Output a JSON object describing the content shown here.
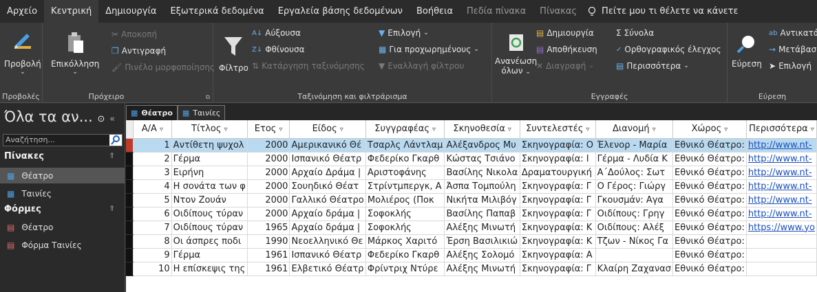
{
  "tabs": [
    {
      "label": "Αρχείο",
      "active": false,
      "contextual": false
    },
    {
      "label": "Κεντρική",
      "active": true,
      "contextual": false
    },
    {
      "label": "Δημιουργία",
      "active": false,
      "contextual": false
    },
    {
      "label": "Εξωτερικά δεδομένα",
      "active": false,
      "contextual": false
    },
    {
      "label": "Εργαλεία βάσης δεδομένων",
      "active": false,
      "contextual": false
    },
    {
      "label": "Βοήθεια",
      "active": false,
      "contextual": false
    },
    {
      "label": "Πεδία πίνακα",
      "active": false,
      "contextual": true
    },
    {
      "label": "Πίνακας",
      "active": false,
      "contextual": true
    }
  ],
  "tell_me": "Πείτε μου τι θέλετε να κάνετε",
  "ribbon": {
    "views": {
      "view": "Προβολή",
      "group": "Προβολές"
    },
    "clipboard": {
      "paste": "Επικόλληση",
      "cut": "Αποκοπή",
      "copy": "Αντιγραφή",
      "format_painter": "Πινέλο μορφοποίησης",
      "group": "Πρόχειρο"
    },
    "sort": {
      "filter": "Φίλτρο",
      "asc": "Αύξουσα",
      "desc": "Φθίνουσα",
      "remove_sort": "Κατάργηση ταξινόμησης",
      "selection": "Επιλογή",
      "advanced": "Για προχωρημένους",
      "toggle_filter": "Εναλλαγή φίλτρου",
      "group": "Ταξινόμηση και φιλτράρισμα"
    },
    "records": {
      "refresh": "Ανανέωση",
      "refresh2": "όλων",
      "new": "Δημιουργία",
      "save": "Αποθήκευση",
      "delete": "Διαγραφή",
      "totals": "Σύνολα",
      "spelling": "Ορθογραφικός έλεγχος",
      "more": "Περισσότερα",
      "group": "Εγγραφές"
    },
    "find": {
      "find": "Εύρεση",
      "replace": "Αντικατάσταση",
      "goto": "Μετάβαση",
      "select": "Επιλογή",
      "group": "Εύρεση"
    }
  },
  "nav": {
    "title": "Όλα τα αν...",
    "search_placeholder": "Αναζήτηση...",
    "tables_header": "Πίνακες",
    "tables": [
      "Θέατρο",
      "Ταινίες"
    ],
    "forms_header": "Φόρμες",
    "forms": [
      "Θέατρο",
      "Φόρμα Ταινίες"
    ]
  },
  "doc_tabs": [
    "Θέατρο",
    "Ταινίες"
  ],
  "columns": [
    "Α/Α",
    "Τίτλος",
    "Ετος",
    "Είδος",
    "Συγγραφέας",
    "Σκηνοθεσία",
    "Συντελεστές",
    "Διανομή",
    "Χώρος",
    "Περισσότερα"
  ],
  "rows": [
    [
      "1",
      "Αντίθετη ψυχολ",
      "2000",
      "Αμερικανικό Θέ",
      "Τσαρλς Λάντλαμ",
      "Αλέξανδρος Μυ",
      "Σκηνογραφία: Ο",
      "Έλενορ - Μαρία",
      "Εθνικό Θέατρο:",
      "http://www.nt-"
    ],
    [
      "2",
      "Γέρμα",
      "2000",
      "Ισπανικό Θέατρ",
      "Φεδερίκο Γκαρθ",
      "Κώστας Τσιάνο",
      "Σκηνογραφία: Ι",
      "Γέρμα - Λυδία Κ",
      "Εθνικό Θέατρο:",
      "http://www.nt-"
    ],
    [
      "3",
      "Ειρήνη",
      "2000",
      "Αρχαίο Δράμα |",
      "Αριστοφάνης",
      "Βασίλης Νικολα",
      "Δραματουργική",
      "Α΄Δούλος: Σωτ",
      "Εθνικό Θέατρο:",
      "http://www.nt-"
    ],
    [
      "4",
      "Η σονάτα των φ",
      "2000",
      "Σουηδικό Θέατ",
      "Στρίντμπεργκ, Α",
      "Άσπα Τομπούλη",
      "Σκηνογραφία: Γ",
      "Ο Γέρος: Γιώργ",
      "Εθνικό Θέατρο:",
      "http://www.nt-"
    ],
    [
      "5",
      "Ντον Ζουάν",
      "2000",
      "Γαλλικό Θέατρο",
      "Μολιέρος (Ποκ",
      "Νικήτα Μιλιβόγ",
      "Σκηνογραφία: Γ",
      "Γκουσμάν: Αγα",
      "Εθνικό Θέατρο:",
      "http://www.nt-"
    ],
    [
      "6",
      "Οιδίπους τύραν",
      "2000",
      "Αρχαίο δράμα |",
      "Σοφοκλής",
      "Βασίλης Παπαβ",
      "Σκηνογραφία: Γ",
      "Οιδίπους: Γρηγ",
      "Εθνικό Θέατρο:",
      "http://www.nt-"
    ],
    [
      "7",
      "Οιδίπους τύραν",
      "1965",
      "Αρχαίο δράμα |",
      "Σοφοκλής",
      "Αλέξης Μινωτή",
      "Σκηνογραφία: Κ",
      "Οιδίπους: Αλέξ",
      "Εθνικό Θέατρο:",
      "https://www.yo"
    ],
    [
      "8",
      "Οι άσπρες ποδι",
      "1990",
      "Νεοελληνικό Θε",
      "Μάρκος Χαριτό",
      "Έρση Βασιλικιώ",
      "Σκηνογραφία: Κ",
      "Τζων - Νίκος Γα",
      "Εθνικό Θέατρο:",
      ""
    ],
    [
      "9",
      "Γέρμα",
      "1961",
      "Ισπανικό Θέατρ",
      "Φεδερίκο Γκαρθ",
      "Αλέξης Σολομό",
      "Σκηνογραφία: Α",
      "",
      "Εθνικό Θέατρο:",
      ""
    ],
    [
      "10",
      "Η επίσκεψις της",
      "1961",
      "Ελβετικό Θέατρ",
      "Φρίντριχ Ντύρε",
      "Αλέξης Μινωτή",
      "Σκηνογραφία: Γ",
      "Κλαίρη Ζαχανασ",
      "Εθνικό Θέατρο:",
      ""
    ]
  ],
  "colors": {
    "accent_selected_row": "#b9d9f0",
    "record_marker": "#c0392b",
    "link": "#1a4fbf"
  }
}
